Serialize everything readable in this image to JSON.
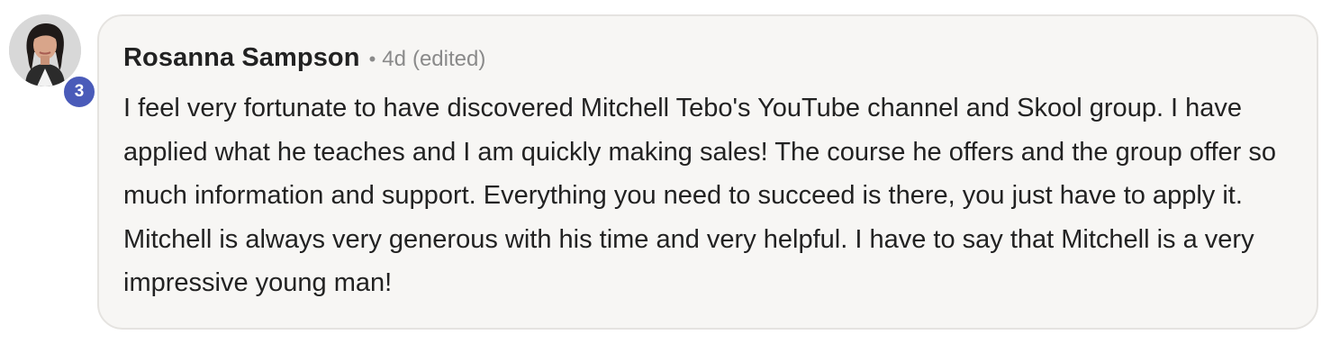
{
  "comment": {
    "author": "Rosanna Sampson",
    "separator": "•",
    "time": "4d",
    "edited": "(edited)",
    "level": "3",
    "text": "I feel very fortunate to have discovered Mitchell Tebo's YouTube channel and Skool group. I have applied what he teaches and I am quickly making sales! The course he offers and the group offer so much information and support. Everything you need to succeed is there, you just have to apply it. Mitchell is always very generous with his time and very helpful. I have to say that Mitchell is a very impressive young man!"
  },
  "colors": {
    "bubble_bg": "#f7f6f4",
    "bubble_border": "#e5e3e0",
    "badge": "#4a5bb9",
    "text": "#222222",
    "meta": "#8a8a8a"
  },
  "icons": {
    "avatar": "profile-photo"
  }
}
